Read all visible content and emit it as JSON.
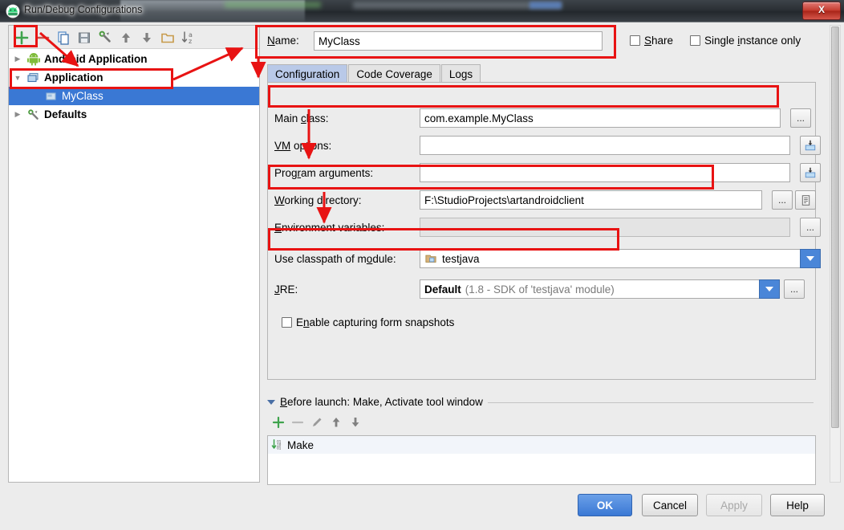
{
  "window": {
    "title": "Run/Debug Configurations",
    "app_icon": "android-studio-icon",
    "close_label": "X"
  },
  "tree": {
    "toolbar": [
      {
        "name": "add-configuration-button",
        "icon": "plus-icon",
        "label": "+"
      },
      {
        "name": "remove-configuration-button",
        "icon": "minus-icon",
        "label": "−"
      },
      {
        "name": "copy-configuration-button",
        "icon": "copy-icon",
        "label": ""
      },
      {
        "name": "save-configuration-button",
        "icon": "save-icon",
        "label": ""
      },
      {
        "name": "edit-defaults-button",
        "icon": "wrench-icon",
        "label": ""
      },
      {
        "name": "move-up-button",
        "icon": "arrow-up-icon",
        "label": ""
      },
      {
        "name": "move-down-button",
        "icon": "arrow-down-icon",
        "label": ""
      },
      {
        "name": "new-folder-button",
        "icon": "folder-icon",
        "label": ""
      },
      {
        "name": "sort-configurations-button",
        "icon": "sort-az-icon",
        "label": ""
      }
    ],
    "items": [
      {
        "label": "Android Application",
        "icon": "android-icon",
        "expanded": false,
        "selected": false,
        "indent": 0
      },
      {
        "label": "Application",
        "icon": "application-icon",
        "expanded": true,
        "selected": false,
        "indent": 0
      },
      {
        "label": "MyClass",
        "icon": "run-config-icon",
        "expanded": null,
        "selected": true,
        "indent": 1
      },
      {
        "label": "Defaults",
        "icon": "wrench-icon",
        "expanded": false,
        "selected": false,
        "indent": 0
      }
    ]
  },
  "config": {
    "name_label": "Name:",
    "name_label_mnemonic": "N",
    "name_value": "MyClass",
    "share": {
      "label": "Share",
      "mnemonic": "S",
      "checked": false
    },
    "single_instance": {
      "label": "Single instance only",
      "mnemonic": "i",
      "checked": false
    },
    "tabs": [
      {
        "label": "Configuration",
        "active": true
      },
      {
        "label": "Code Coverage",
        "active": false
      },
      {
        "label": "Logs",
        "active": false
      }
    ],
    "fields": {
      "main_class": {
        "label_pre": "Main ",
        "label_mn": "c",
        "label_post": "lass:",
        "value": "com.example.MyClass",
        "browse": "..."
      },
      "vm_options": {
        "label_pre": "",
        "label_mn": "VM",
        "label_post": " options:",
        "value": "",
        "expand_icon": "expand-field-icon"
      },
      "program_arguments": {
        "label_pre": "Prog",
        "label_mn": "r",
        "label_post": "am arguments:",
        "value": "",
        "expand_icon": "expand-field-icon"
      },
      "working_directory": {
        "label_pre": "",
        "label_mn": "W",
        "label_post": "orking directory:",
        "value": "F:\\StudioProjects\\artandroidclient",
        "browse": "...",
        "macro_icon": "macro-list-icon"
      },
      "environment_variables": {
        "label_pre": "",
        "label_mn": "E",
        "label_post": "nvironment variables:",
        "value": "",
        "browse": "...",
        "disabled": true
      },
      "use_classpath_of_module": {
        "label_pre": "Use classpath of m",
        "label_mn": "o",
        "label_post": "dule:",
        "value": "testjava",
        "icon": "module-icon"
      },
      "jre": {
        "label_pre": "",
        "label_mn": "J",
        "label_post": "RE:",
        "value_bold": "Default",
        "value_gray": "(1.8 - SDK of 'testjava' module)",
        "browse": "..."
      }
    },
    "enable_snapshots": {
      "label_pre": "E",
      "label_mn": "n",
      "label_post": "able capturing form snapshots",
      "full": "Enable capturing form snapshots",
      "checked": false
    }
  },
  "before_launch": {
    "header": "Before launch: Make, Activate tool window",
    "header_mnemonic": "B",
    "toolbar": [
      {
        "name": "add-task-button",
        "icon": "plus-icon"
      },
      {
        "name": "remove-task-button",
        "icon": "minus-icon"
      },
      {
        "name": "edit-task-button",
        "icon": "pencil-icon"
      },
      {
        "name": "move-task-up-button",
        "icon": "arrow-up-icon"
      },
      {
        "name": "move-task-down-button",
        "icon": "arrow-down-icon"
      }
    ],
    "tasks": [
      {
        "label": "Make",
        "icon": "compile-icon"
      }
    ]
  },
  "buttons": {
    "ok": {
      "label": "OK",
      "primary": true,
      "disabled": false
    },
    "cancel": {
      "label": "Cancel",
      "primary": false,
      "disabled": false
    },
    "apply": {
      "label": "Apply",
      "primary": false,
      "disabled": true
    },
    "help": {
      "label": "Help",
      "primary": false,
      "disabled": false
    }
  },
  "colors": {
    "annotation_red": "#e81313",
    "selection_blue": "#3a78d4",
    "tab_active": "#b9c9e8",
    "panel_bg": "#ececec",
    "accent_blue": "#4a86d8"
  }
}
